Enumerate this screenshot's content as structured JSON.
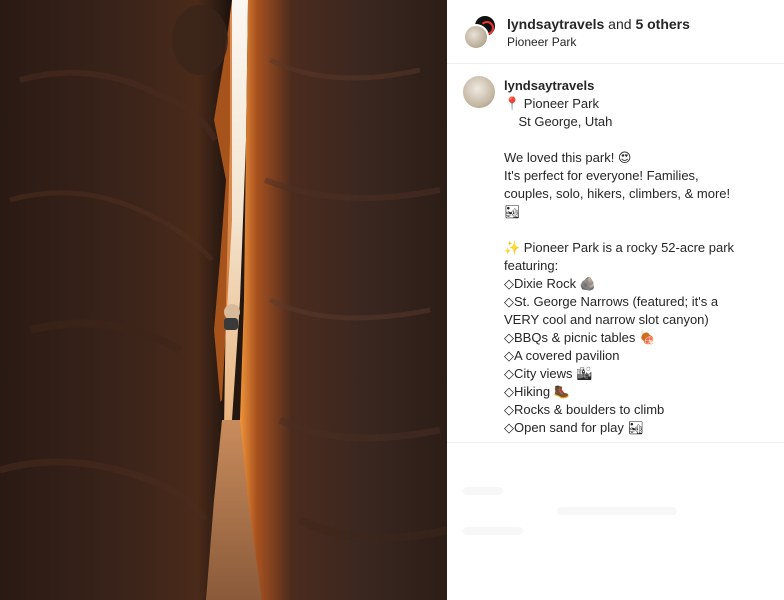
{
  "header": {
    "username": "lyndsaytravels",
    "and_text": " and ",
    "others": "5 others",
    "location": "Pioneer Park"
  },
  "caption": {
    "username": "lyndsaytravels",
    "lines": [
      "📍 Pioneer Park",
      "    St George, Utah",
      "",
      "We loved this park! 😍",
      "It's perfect for everyone! Families,",
      "couples, solo, hikers, climbers, & more!",
      "🏜",
      "",
      "✨ Pioneer Park is a rocky 52-acre park",
      "featuring:",
      "◇Dixie Rock 🪨",
      "◇St. George Narrows (featured; it's a",
      "VERY cool and narrow slot canyon)",
      "◇BBQs & picnic tables 🍖",
      "◇A covered pavilion",
      "◇City views 🏙",
      "◇Hiking 🥾",
      "◇Rocks & boulders to climb",
      "◇Open sand for play 🏜"
    ]
  },
  "photo": {
    "description_icon": "slot-canyon-photo"
  },
  "colors": {
    "text": "#262626",
    "divider": "#efefef",
    "rock_dark": "#1a0f0a",
    "rock_glow": "#e07a2a",
    "sky": "#f4efe6"
  }
}
